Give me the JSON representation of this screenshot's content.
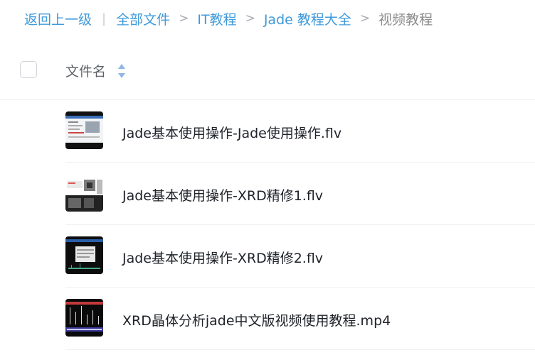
{
  "breadcrumb": {
    "back": "返回上一级",
    "divider": "|",
    "sep": ">",
    "items": [
      "全部文件",
      "IT教程",
      "Jade 教程大全"
    ],
    "current": "视频教程"
  },
  "header": {
    "column_name": "文件名"
  },
  "files": [
    {
      "name": "Jade基本使用操作-Jade使用操作.flv",
      "thumb_icon": "video-thumbnail-screen-icon"
    },
    {
      "name": "Jade基本使用操作-XRD精修1.flv",
      "thumb_icon": "video-thumbnail-screen-icon"
    },
    {
      "name": "Jade基本使用操作-XRD精修2.flv",
      "thumb_icon": "video-thumbnail-screen-icon"
    },
    {
      "name": "XRD晶体分析jade中文版视频使用教程.mp4",
      "thumb_icon": "video-thumbnail-screen-icon"
    }
  ],
  "colors": {
    "link": "#3f9bdc",
    "muted": "#8c8c8c",
    "sort_icon": "#8fb8e3"
  }
}
